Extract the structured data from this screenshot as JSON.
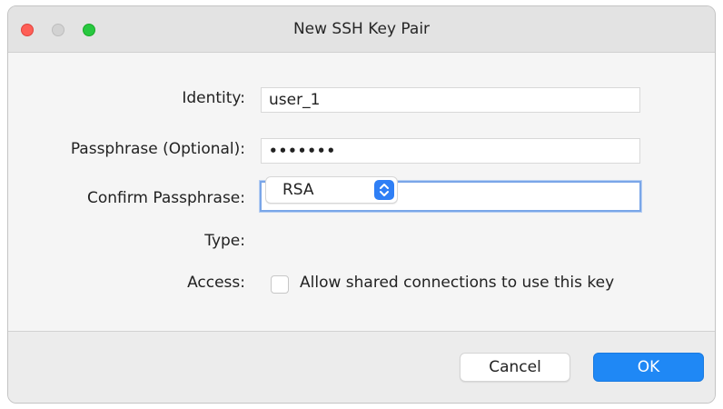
{
  "window": {
    "title": "New SSH Key Pair"
  },
  "form": {
    "identity": {
      "label": "Identity:",
      "value": "user_1"
    },
    "passphrase": {
      "label": "Passphrase (Optional):",
      "value": "•••••••"
    },
    "confirm": {
      "label": "Confirm Passphrase:",
      "value": "•••••••"
    },
    "type": {
      "label": "Type:",
      "value": "RSA"
    },
    "access": {
      "label": "Access:",
      "checkbox_label": "Allow shared connections to use this key",
      "checked": false
    }
  },
  "buttons": {
    "cancel": "Cancel",
    "ok": "OK"
  },
  "colors": {
    "accent": "#1f88f5",
    "close": "#fe5f57",
    "zoom": "#28c840",
    "focus_ring": "#7aa6e8"
  },
  "icons": {
    "close": "close-dot-icon",
    "minimize": "minimize-dot-icon",
    "zoom": "zoom-dot-icon",
    "select_stepper": "chevron-up-down-icon"
  }
}
